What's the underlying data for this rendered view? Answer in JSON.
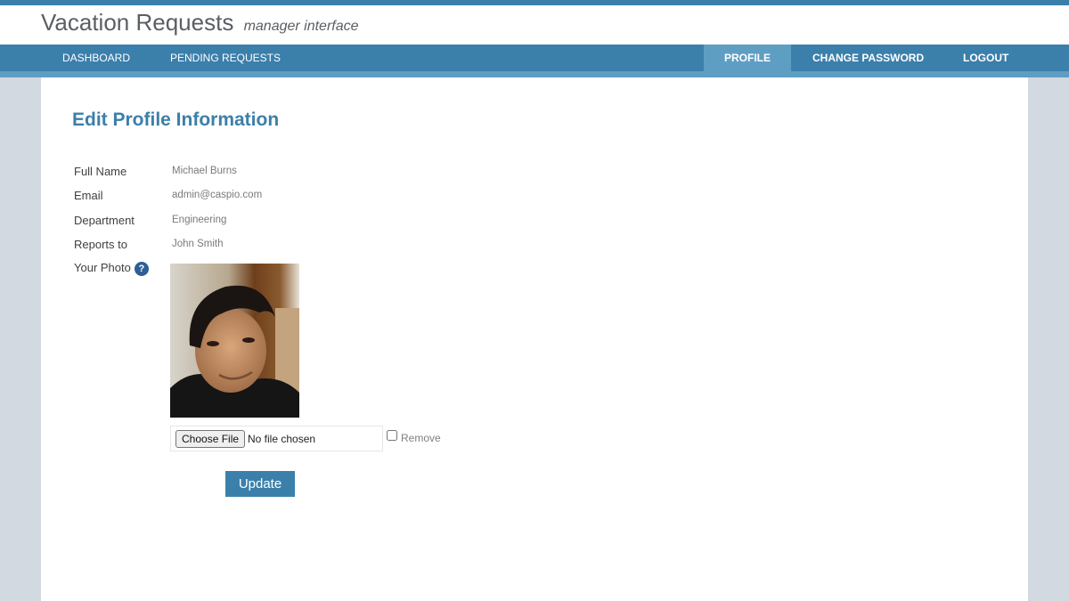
{
  "header": {
    "title": "Vacation Requests",
    "subtitle": "manager interface"
  },
  "nav": {
    "left": [
      {
        "label": "DASHBOARD"
      },
      {
        "label": "PENDING REQUESTS"
      }
    ],
    "right": [
      {
        "label": "PROFILE",
        "active": true
      },
      {
        "label": "CHANGE PASSWORD"
      },
      {
        "label": "LOGOUT"
      }
    ]
  },
  "form": {
    "title": "Edit Profile Information",
    "fields": [
      {
        "label": "Full Name",
        "value": "Michael Burns"
      },
      {
        "label": "Email",
        "value": "admin@caspio.com"
      },
      {
        "label": "Department",
        "value": "Engineering"
      },
      {
        "label": "Reports to",
        "value": "John Smith"
      }
    ],
    "photo_label": "Your Photo",
    "help_icon": "?",
    "choose_file_label": "Choose File",
    "no_file_text": "No file chosen",
    "remove_label": "Remove",
    "update_label": "Update"
  },
  "colors": {
    "accent": "#3b80ab",
    "nav_active": "#5f9ec3",
    "title": "#3c7fa9",
    "background": "#d3d9e0"
  }
}
